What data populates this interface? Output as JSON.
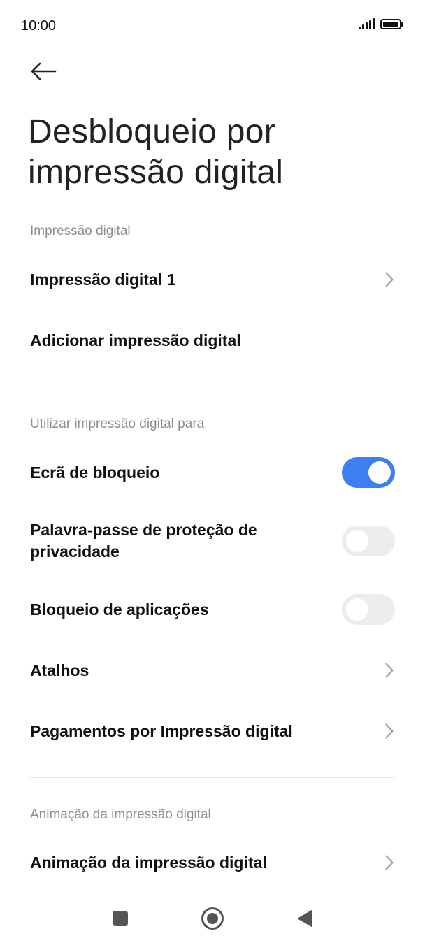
{
  "status_bar": {
    "time": "10:00"
  },
  "page": {
    "title": "Desbloqueio por impressão digital"
  },
  "sections": {
    "fingerprint": {
      "header": "Impressão digital",
      "item1": "Impressão digital 1",
      "item2": "Adicionar impressão digital"
    },
    "use_for": {
      "header": "Utilizar impressão digital para",
      "lock_screen": {
        "label": "Ecrã de bloqueio",
        "enabled": true
      },
      "privacy_password": {
        "label": "Palavra-passe de proteção de privacidade",
        "enabled": false
      },
      "app_lock": {
        "label": "Bloqueio de aplicações",
        "enabled": false
      },
      "shortcuts": "Atalhos",
      "payments": "Pagamentos por Impressão digital"
    },
    "animation": {
      "header": "Animação da impressão digital",
      "item": "Animação da impressão digital"
    }
  },
  "colors": {
    "accent": "#3d7ef0",
    "toggle_off": "#ececec",
    "section_header": "#8c8c95"
  }
}
